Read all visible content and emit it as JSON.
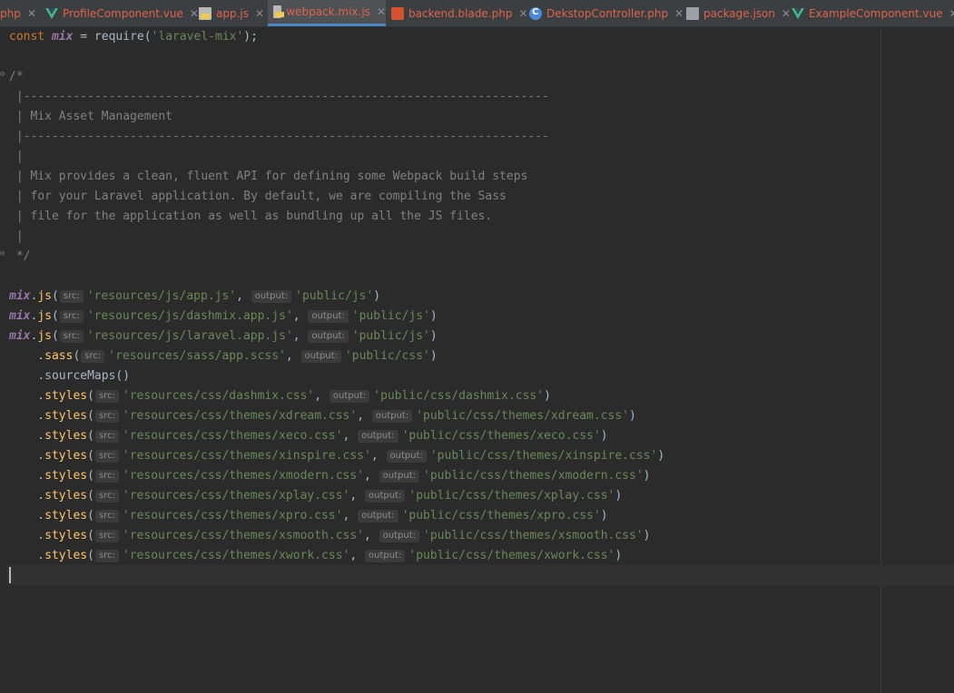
{
  "tabs": [
    {
      "label": "php",
      "icon": "none",
      "color": "#e0634a"
    },
    {
      "label": "ProfileComponent.vue",
      "icon": "vue-icon",
      "color": "#e0634a"
    },
    {
      "label": "app.js",
      "icon": "js-file-icon",
      "color": "#e0634a"
    },
    {
      "label": "webpack.mix.js",
      "icon": "js-file-icon",
      "color": "#e0634a",
      "active": true
    },
    {
      "label": "backend.blade.php",
      "icon": "blade-icon",
      "color": "#e0634a"
    },
    {
      "label": "DekstopController.php",
      "icon": "php-class-icon",
      "color": "#e0634a"
    },
    {
      "label": "package.json",
      "icon": "json-file-icon",
      "color": "#e0634a"
    },
    {
      "label": "ExampleComponent.vue",
      "icon": "vue-icon",
      "color": "#e0634a"
    }
  ],
  "code": {
    "require_line": {
      "kw": "const",
      "var": "mix",
      "rest": " = require(",
      "module": "'laravel-mix'",
      "end": ");"
    },
    "comment": [
      "/*",
      " |--------------------------------------------------------------------------",
      " | Mix Asset Management",
      " |--------------------------------------------------------------------------",
      " |",
      " | Mix provides a clean, fluent API for defining some Webpack build steps",
      " | for your Laravel application. By default, we are compiling the Sass",
      " | file for the application as well as bundling up all the JS files.",
      " |",
      " */"
    ],
    "hints": {
      "src": "src:",
      "output": "output:"
    },
    "js_calls": [
      {
        "src": "'resources/js/app.js'",
        "out": "'public/js'"
      },
      {
        "src": "'resources/js/dashmix.app.js'",
        "out": "'public/js'"
      },
      {
        "src": "'resources/js/laravel.app.js'",
        "out": "'public/js'"
      }
    ],
    "sass": {
      "src": "'resources/sass/app.scss'",
      "out": "'public/css'"
    },
    "source_maps": ".sourceMaps()",
    "styles": [
      {
        "src": "'resources/css/dashmix.css'",
        "out": "'public/css/dashmix.css'"
      },
      {
        "src": "'resources/css/themes/xdream.css'",
        "out": "'public/css/themes/xdream.css'"
      },
      {
        "src": "'resources/css/themes/xeco.css'",
        "out": "'public/css/themes/xeco.css'"
      },
      {
        "src": "'resources/css/themes/xinspire.css'",
        "out": "'public/css/themes/xinspire.css'"
      },
      {
        "src": "'resources/css/themes/xmodern.css'",
        "out": "'public/css/themes/xmodern.css'"
      },
      {
        "src": "'resources/css/themes/xplay.css'",
        "out": "'public/css/themes/xplay.css'"
      },
      {
        "src": "'resources/css/themes/xpro.css'",
        "out": "'public/css/themes/xpro.css'"
      },
      {
        "src": "'resources/css/themes/xsmooth.css'",
        "out": "'public/css/themes/xsmooth.css'"
      },
      {
        "src": "'resources/css/themes/xwork.css'",
        "out": "'public/css/themes/xwork.css'"
      }
    ]
  }
}
